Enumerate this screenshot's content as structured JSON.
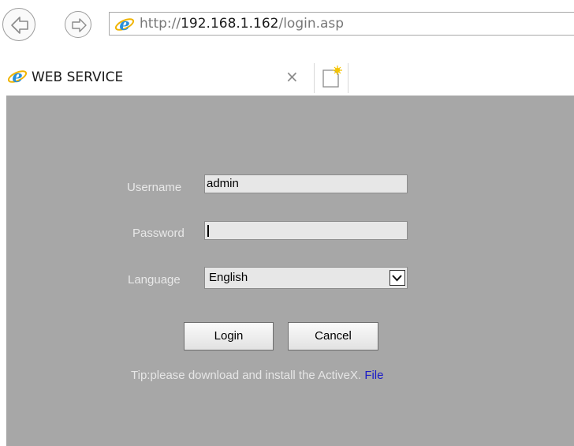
{
  "browser": {
    "address": {
      "prefix": "http://",
      "host": "192.168.1.162",
      "path": "/login.asp"
    },
    "tab": {
      "title": "WEB SERVICE",
      "close_glyph": "×"
    },
    "icons": {
      "back": "back-arrow-icon",
      "forward": "forward-arrow-icon",
      "page": "internet-explorer-icon",
      "new_tab": "new-tab-icon"
    }
  },
  "login_form": {
    "username": {
      "label": "Username",
      "value": "admin"
    },
    "password": {
      "label": "Password",
      "value": ""
    },
    "language": {
      "label": "Language",
      "selected": "English"
    },
    "login_button": "Login",
    "cancel_button": "Cancel",
    "tip": {
      "text": "Tip:please download and install the ActiveX.",
      "link": "File"
    }
  },
  "colors": {
    "page_background": "#a7a7a7",
    "label_text": "#e8e8e8",
    "link": "#1a1ac8",
    "ie_blue": "#2a8fd8"
  }
}
